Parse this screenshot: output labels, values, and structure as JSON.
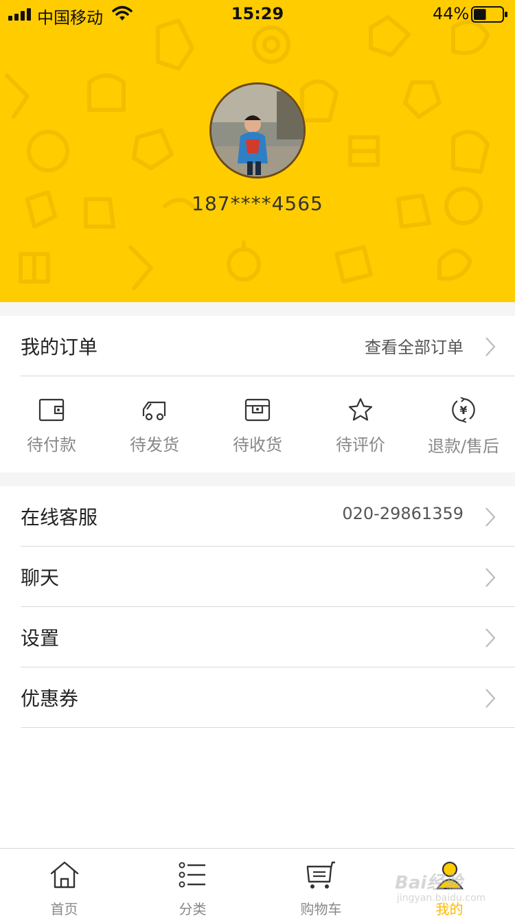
{
  "status_bar": {
    "carrier": "中国移动",
    "time": "15:29",
    "battery": "44%",
    "battery_level": 0.44
  },
  "profile": {
    "phone": "187****4565"
  },
  "orders": {
    "title": "我的订单",
    "view_all": "查看全部订单",
    "statuses": [
      {
        "label": "待付款",
        "icon": "wallet-icon"
      },
      {
        "label": "待发货",
        "icon": "truck-icon"
      },
      {
        "label": "待收货",
        "icon": "box-icon"
      },
      {
        "label": "待评价",
        "icon": "star-icon"
      },
      {
        "label": "退款/售后",
        "icon": "refund-icon"
      }
    ]
  },
  "menu": {
    "service_label": "在线客服",
    "service_phone": "020-29861359",
    "chat_label": "聊天",
    "settings_label": "设置",
    "coupons_label": "优惠券"
  },
  "tabbar": {
    "tabs": [
      {
        "label": "首页",
        "icon": "home-icon"
      },
      {
        "label": "分类",
        "icon": "list-icon"
      },
      {
        "label": "购物车",
        "icon": "cart-icon"
      },
      {
        "label": "我的",
        "icon": "user-icon",
        "active": true
      }
    ]
  },
  "watermark": {
    "brand": "Bai经验",
    "url": "jingyan.baidu.com"
  },
  "colors": {
    "accent": "#FFCC00",
    "active_tab": "#FFB800"
  }
}
